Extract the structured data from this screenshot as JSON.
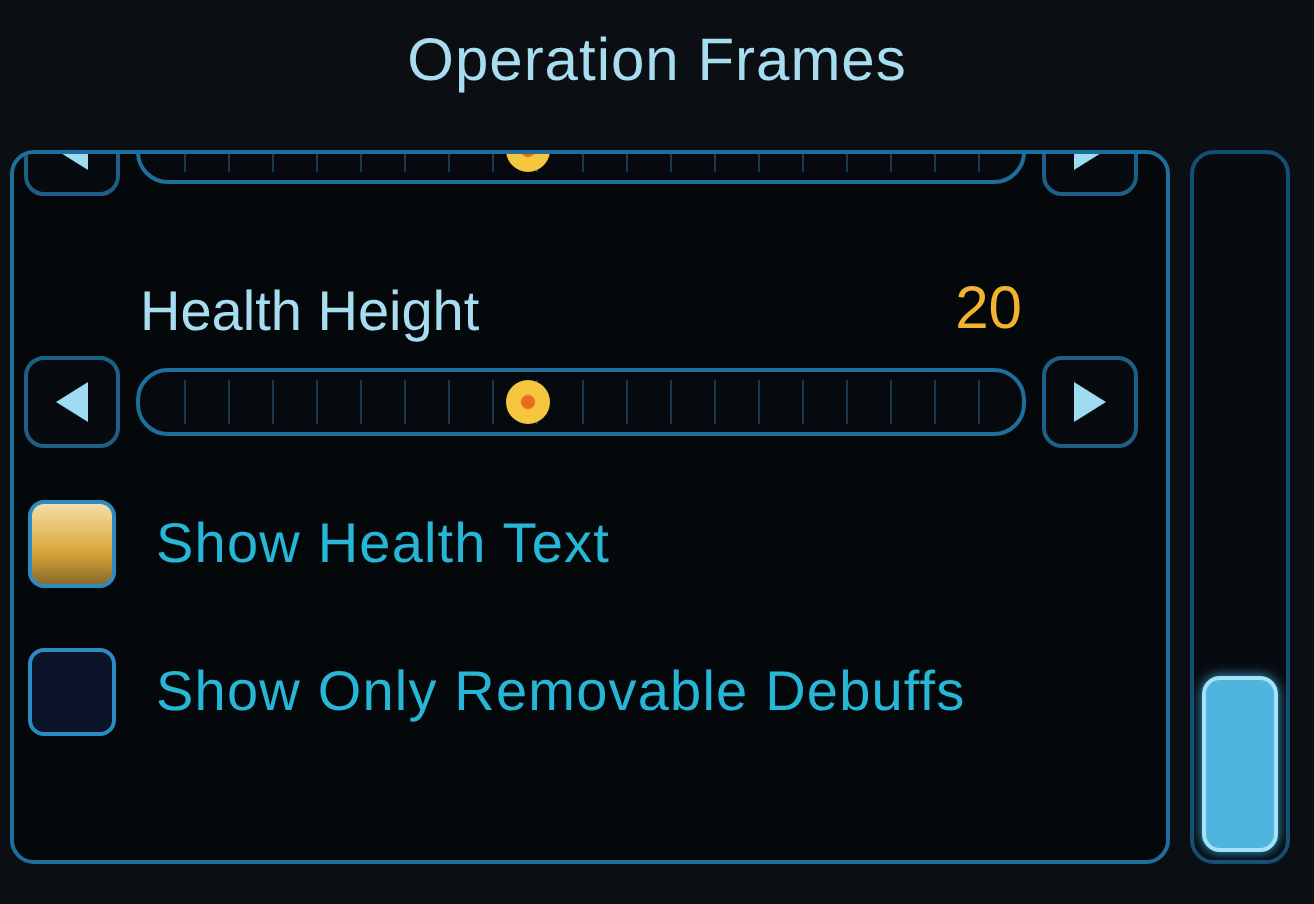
{
  "title": "Operation Frames",
  "options": [
    {
      "kind": "slider",
      "level": 0.44
    },
    {
      "kind": "slider",
      "label": "Health Height",
      "value": "20",
      "level": 0.44
    },
    {
      "kind": "checkbox",
      "label": "Show Health Text",
      "checked": true
    },
    {
      "kind": "checkbox",
      "label": "Show Only Removable Debuffs",
      "checked": false
    }
  ]
}
